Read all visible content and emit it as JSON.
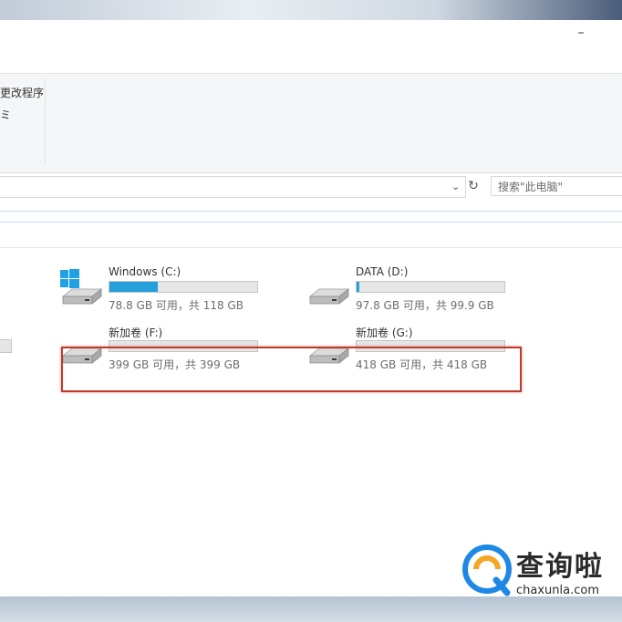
{
  "window": {
    "minimize_label": "–"
  },
  "ribbon": {
    "item1": "更改程序",
    "item2": "ミ"
  },
  "search": {
    "placeholder": "搜索\"此电脑\""
  },
  "drives": [
    {
      "name": "Windows (C:)",
      "info": "78.8 GB 可用，共 118 GB",
      "used_fraction": 0.33,
      "icon": "windows-drive-icon"
    },
    {
      "name": "DATA (D:)",
      "info": "97.8 GB 可用，共 99.9 GB",
      "used_fraction": 0.02,
      "icon": "drive-icon"
    },
    {
      "name": "新加卷 (F:)",
      "info": "399 GB 可用，共 399 GB",
      "used_fraction": 0.0,
      "icon": "drive-icon"
    },
    {
      "name": "新加卷 (G:)",
      "info": "418 GB 可用，共 418 GB",
      "used_fraction": 0.0,
      "icon": "drive-icon"
    }
  ],
  "colors": {
    "bar_fill": "#26a0da",
    "highlight": "#c0392b"
  },
  "watermark": {
    "brand": "查询啦",
    "url": "chaxunla.com"
  }
}
